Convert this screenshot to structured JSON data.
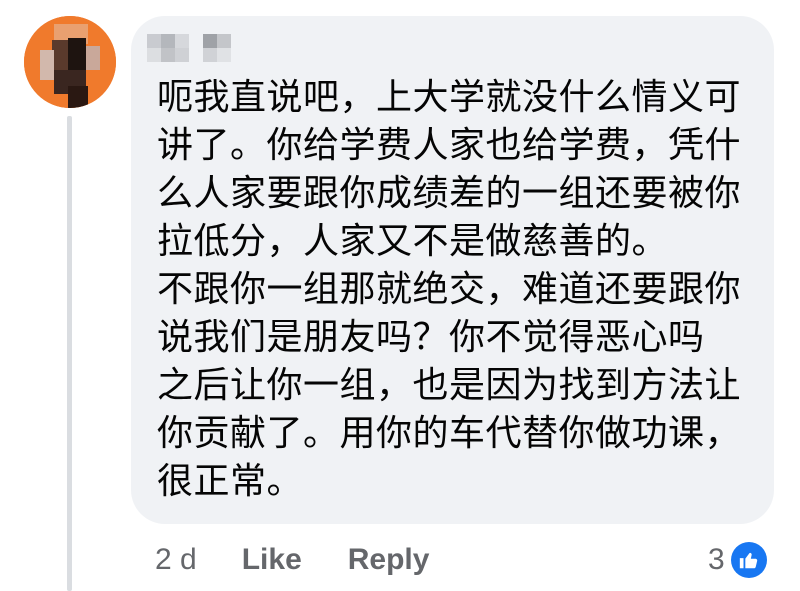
{
  "comment": {
    "author_name": "",
    "lines": [
      "呃我直说吧，上大学就没什么情义可",
      "讲了。你给学费人家也给学费，凭什",
      "么人家要跟你成绩差的一组还要被你",
      "拉低分，人家又不是做慈善的。",
      "不跟你一组那就绝交，难道还要跟你",
      "说我们是朋友吗？你不觉得恶心吗",
      "之后让你一组，也是因为找到方法让",
      "你贡献了。用你的车代替你做功课，",
      "很正常。"
    ]
  },
  "actions": {
    "timestamp": "2 d",
    "like_label": "Like",
    "reply_label": "Reply"
  },
  "reactions": {
    "count": "3",
    "icon": "thumbs-up-icon"
  },
  "colors": {
    "bubble": "#f0f2f5",
    "text": "#050505",
    "meta": "#65676b",
    "like_blue": "#1877f2",
    "avatar_orange": "#f0782a"
  }
}
